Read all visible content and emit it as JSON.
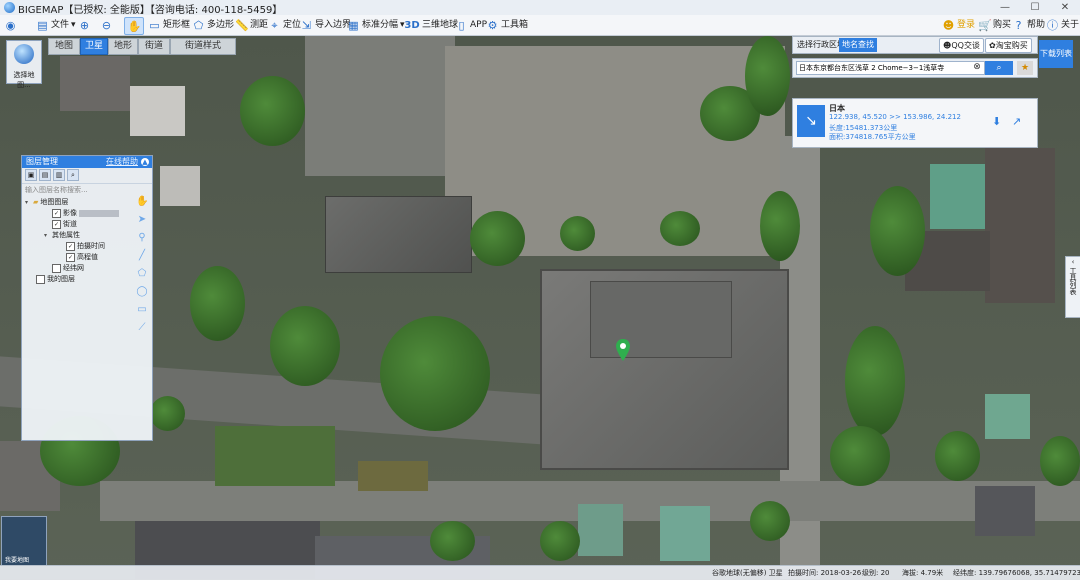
{
  "app": {
    "title_line": "BIGEMAP【已授权: 全能版】【咨询电话: 400-118-5459】"
  },
  "window_controls": {
    "minimize": "—",
    "maximize": "☐",
    "close": "✕"
  },
  "toolbar": {
    "file": "文件",
    "zoom_in": "",
    "zoom_out": "",
    "rectangle": "矩形框",
    "polygon": "多边形",
    "measure": "测距",
    "locate": "定位",
    "import_boundary": "导入边界",
    "std_grid": "标准分幅",
    "three_d": "三维地球",
    "app": "APP",
    "toolbox": "工具箱",
    "login": "登录",
    "buy": "购买",
    "help": "帮助",
    "about": "关于"
  },
  "map_tabs": [
    {
      "label": "地图",
      "active": false
    },
    {
      "label": "卫星",
      "active": true
    },
    {
      "label": "地形",
      "active": false
    },
    {
      "label": "街道",
      "active": false
    },
    {
      "label": "街道样式",
      "active": false
    }
  ],
  "location_button": {
    "label": "选择地图..."
  },
  "layers_panel": {
    "title": "图层管理",
    "help_link": "在线帮助",
    "search_placeholder": "输入图层名称搜索...",
    "items": [
      {
        "label": "地图图层",
        "level": 0,
        "checked": null,
        "expanded": true
      },
      {
        "label": "影像",
        "level": 1,
        "checked": true
      },
      {
        "label": "街道",
        "level": 1,
        "checked": true
      },
      {
        "label": "其他属性",
        "level": 1,
        "checked": null,
        "expanded": true
      },
      {
        "label": "拍摄时间",
        "level": 2,
        "checked": true
      },
      {
        "label": "高程值",
        "level": 2,
        "checked": true
      },
      {
        "label": "经纬网",
        "level": 1,
        "checked": false
      },
      {
        "label": "我的图层",
        "level": 0,
        "checked": false
      }
    ]
  },
  "right_panel": {
    "tabs": [
      {
        "label": "选择行政区域",
        "active": false
      },
      {
        "label": "地名查找",
        "active": true
      }
    ],
    "qq_button": "QQ交谈",
    "taobao_button": "淘宝购买",
    "search_value": "日本东京都台东区浅草 2 Chome−3−1浅草寺",
    "download_list": "下载列表",
    "result": {
      "name": "日本",
      "coords": "122.938, 45.520 >> 153.986, 24.212",
      "perimeter": "长度:15481.373公里",
      "area": "面积:374818.765平方公里"
    }
  },
  "right_tools_label": "工具列表",
  "minimap_label": "我要地图",
  "status_bar": {
    "source": "谷歌地球(无偏移) 卫星",
    "shot_time": "拍摄时间: 2018-03-26",
    "level": "级别: 20",
    "elevation": "海拔: 4.79米",
    "lonlat": "经纬度: 139.79676068, 35.71479723"
  },
  "colors": {
    "accent": "#2f7fe0",
    "pin": "#2fae4e"
  }
}
